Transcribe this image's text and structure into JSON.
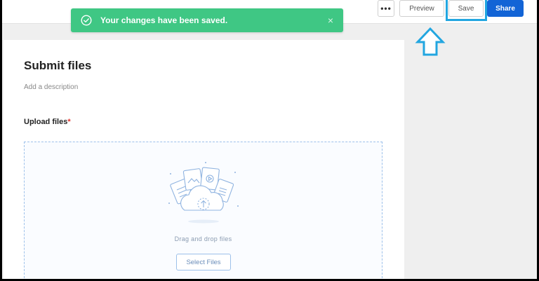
{
  "toast": {
    "message": "Your changes have been saved.",
    "close_symbol": "×",
    "color": "#3fc784",
    "icon": "check-circle-icon"
  },
  "toolbar": {
    "more_label": "•••",
    "preview_label": "Preview",
    "save_label": "Save",
    "share_label": "Share",
    "share_color": "#1264d6"
  },
  "annotation": {
    "arrow_icon": "up-arrow-icon",
    "color": "#22a6e0"
  },
  "form": {
    "title": "Submit files",
    "description_placeholder": "Add a description",
    "field_label": "Upload files",
    "required_marker": "*",
    "dropzone": {
      "illustration": "cloud-upload-files-icon",
      "text": "Drag and drop files",
      "select_label": "Select Files"
    }
  }
}
